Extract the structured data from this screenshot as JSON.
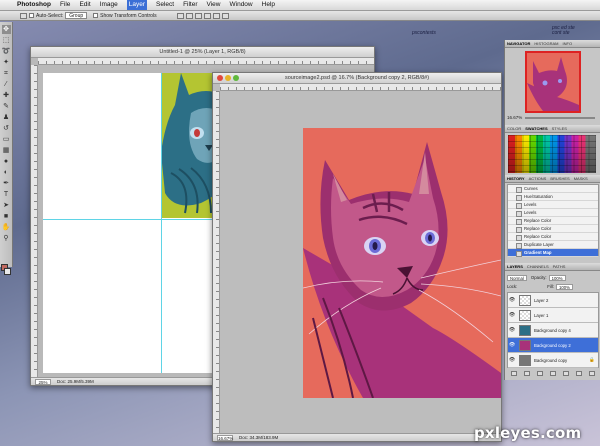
{
  "menubar": {
    "items": [
      "Photoshop",
      "File",
      "Edit",
      "Image",
      "Layer",
      "Select",
      "Filter",
      "View",
      "Window",
      "Help"
    ],
    "active": "Layer"
  },
  "optionsbar": {
    "zoom": "16.7%",
    "auto_select_label": "Auto-Select:",
    "auto_select_value": "Group",
    "show_transform_label": "Show Transform Controls"
  },
  "desktop": {
    "note_left": "pxcontests",
    "note_right": "pxc ed ste",
    "note_right2": "cont ste"
  },
  "doc1": {
    "title": "Untitled-1 @ 25% (Layer 1, RGB/8)",
    "status_zoom": "25%",
    "status_doc": "Doc: 25.9M/5.39M"
  },
  "doc2": {
    "title": "sourceimage2.psd @ 16.7% (Background copy 2, RGB/8#)",
    "status_zoom": "16.67%",
    "status_doc": "Doc: 34.3M/183.9M"
  },
  "navigator": {
    "tabs": [
      "Navigator",
      "Histogram",
      "Info"
    ],
    "zoom": "16.67%"
  },
  "swatches": {
    "tabs": [
      "Color",
      "Swatches",
      "Styles"
    ]
  },
  "history": {
    "tabs": [
      "History",
      "Actions",
      "Brushes",
      "Masks"
    ],
    "items": [
      "Curves",
      "Hue/Saturation",
      "Levels",
      "Levels",
      "Replace Color",
      "Replace Color",
      "Replace Color",
      "Duplicate Layer",
      "Gradient Map"
    ]
  },
  "layers": {
    "tabs": [
      "Layers",
      "Channels",
      "Paths"
    ],
    "blend_mode": "Normal",
    "opacity_label": "Opacity:",
    "opacity": "100%",
    "lock_label": "Lock:",
    "fill_label": "Fill:",
    "fill": "100%",
    "items": [
      "Layer 2",
      "Layer 1",
      "Background copy 4",
      "Background copy 2",
      "Background copy"
    ],
    "selected": "Background copy 2"
  },
  "watermark": "pxleyes.com",
  "colors": {
    "canvas_salmon": "#e66a5c",
    "tile_green": "#b4c532",
    "selection_blue": "#3e6fd8"
  }
}
